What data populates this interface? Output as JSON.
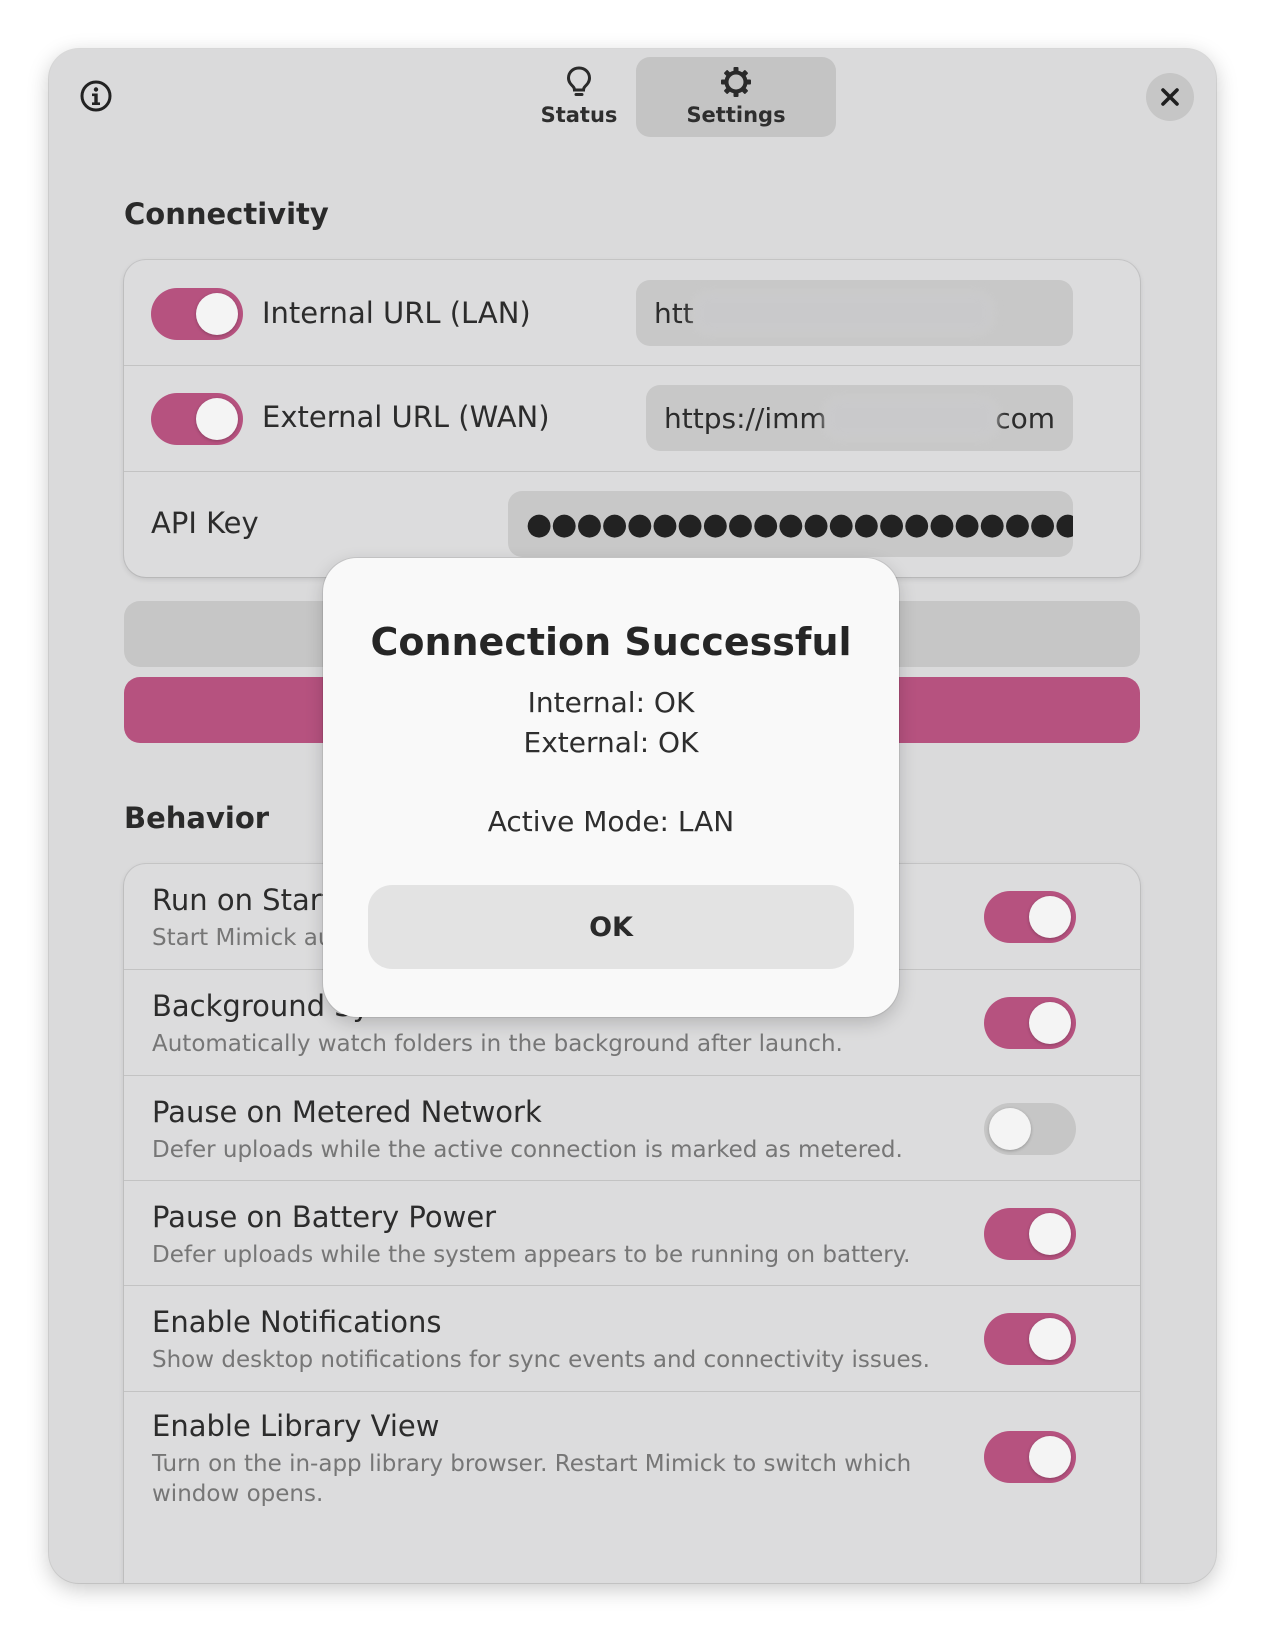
{
  "header": {
    "tabs": [
      {
        "label": "Status",
        "icon": "lightbulb-icon",
        "active": false
      },
      {
        "label": "Settings",
        "icon": "gear-icon",
        "active": true
      }
    ],
    "info_icon": "info-icon",
    "close_icon": "close-icon"
  },
  "connectivity": {
    "title": "Connectivity",
    "internal": {
      "label": "Internal URL (LAN)",
      "enabled": true,
      "value_prefix": "htt"
    },
    "external": {
      "label": "External URL (WAN)",
      "enabled": true,
      "value_prefix": "https://imm",
      "value_suffix": "com"
    },
    "api_key": {
      "label": "API Key",
      "masked": "●●●●●●●●●●●●●●●●●●●●●●●●●"
    }
  },
  "behavior": {
    "title": "Behavior",
    "items": [
      {
        "title": "Run on Startup",
        "subtitle": "Start Mimick automatically when you log in.",
        "enabled": true
      },
      {
        "title": "Background Sync",
        "subtitle": "Automatically watch folders in the background after launch.",
        "enabled": true
      },
      {
        "title": "Pause on Metered Network",
        "subtitle": "Defer uploads while the active connection is marked as metered.",
        "enabled": false
      },
      {
        "title": "Pause on Battery Power",
        "subtitle": "Defer uploads while the system appears to be running on battery.",
        "enabled": true
      },
      {
        "title": "Enable Notifications",
        "subtitle": "Show desktop notifications for sync events and connectivity issues.",
        "enabled": true
      },
      {
        "title": "Enable Library View",
        "subtitle": "Turn on the in-app library browser. Restart Mimick to switch which window opens.",
        "enabled": true
      }
    ]
  },
  "dialog": {
    "title": "Connection Successful",
    "internal_status": "Internal: OK",
    "external_status": "External: OK",
    "active_mode": "Active Mode: LAN",
    "ok_label": "OK"
  },
  "colors": {
    "accent": "#b6527f",
    "window_bg": "#dadadb",
    "dialog_bg": "#f9f9f9"
  }
}
